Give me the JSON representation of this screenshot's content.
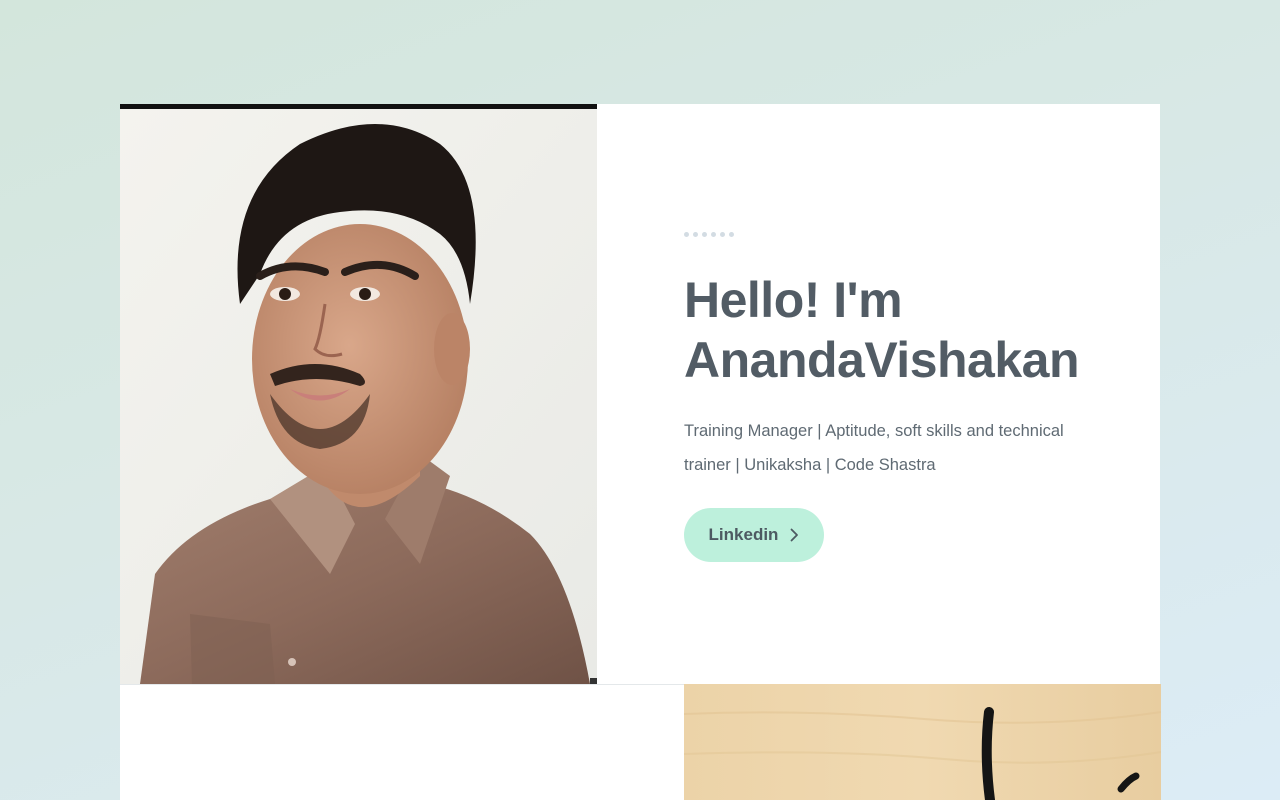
{
  "hero": {
    "portrait_alt": "Portrait photo",
    "headline_line1": "Hello! I'm",
    "headline_line2": "AnandaVishakan",
    "bio": "Training Manager | Aptitude, soft skills and technical trainer | Unikaksha | Code Shastra",
    "cta_label": "Linkedin",
    "cta_icon": "chevron-right-icon"
  },
  "colors": {
    "background": "#d6e8e4",
    "card": "#ffffff",
    "headline": "#525c65",
    "text": "#5f6a73",
    "button": "#bdf0dc"
  }
}
